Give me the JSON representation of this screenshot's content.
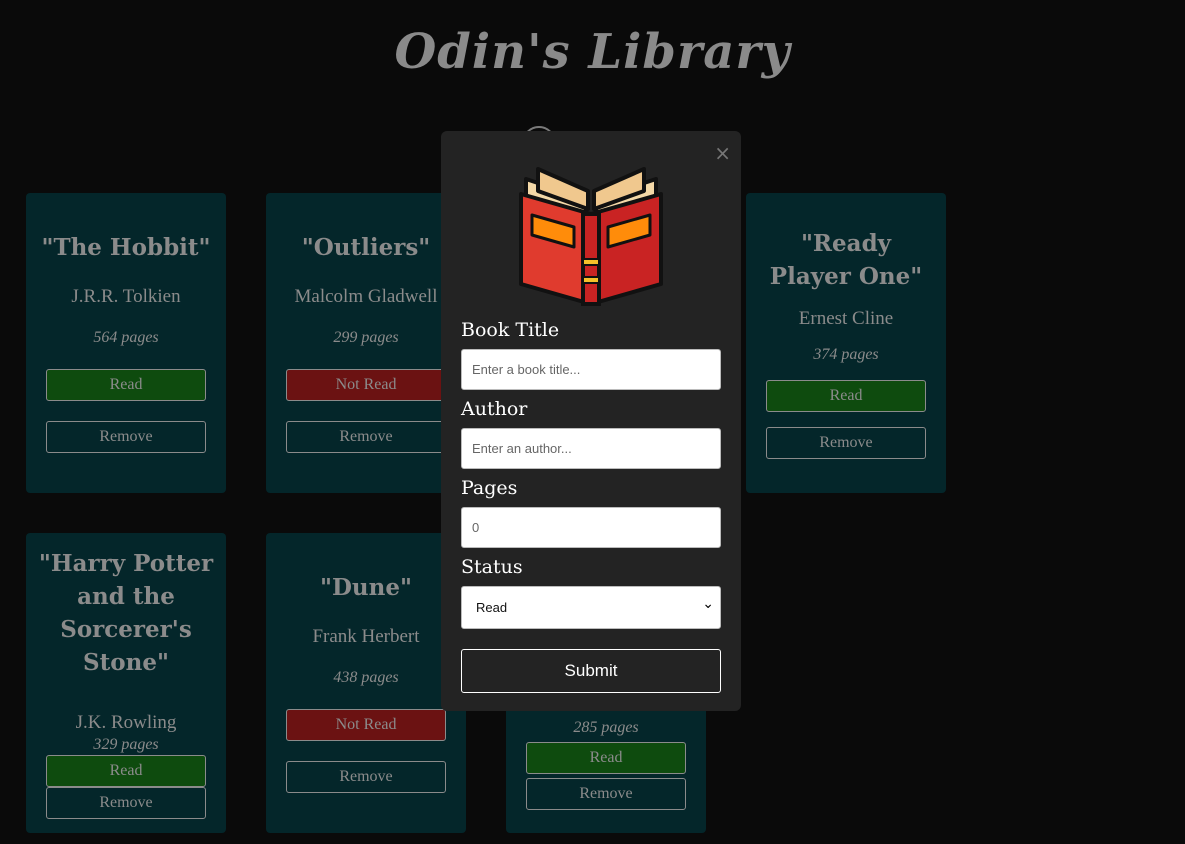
{
  "header": {
    "title": "Odin's Library"
  },
  "books": [
    {
      "title": "\"The Hobbit\"",
      "author": "J.R.R. Tolkien",
      "pages": "564 pages",
      "status": "Read",
      "remove": "Remove"
    },
    {
      "title": "\"Outliers\"",
      "author": "Malcolm Gladwell",
      "pages": "299 pages",
      "status": "Not Read",
      "remove": "Remove"
    },
    {
      "title": "\"Ready Player One\"",
      "author": "Ernest Cline",
      "pages": "374 pages",
      "status": "Read",
      "remove": "Remove"
    },
    {
      "title": "\"Harry Potter and the Sorcerer's Stone\"",
      "author": "J.K. Rowling",
      "pages": "329 pages",
      "status": "Read",
      "remove": "Remove"
    },
    {
      "title": "\"Dune\"",
      "author": "Frank Herbert",
      "pages": "438 pages",
      "status": "Not Read",
      "remove": "Remove"
    },
    {
      "title": "",
      "author": "",
      "pages": "285 pages",
      "status": "Read",
      "remove": "Remove"
    }
  ],
  "modal": {
    "close": "×",
    "title_label": "Book Title",
    "title_placeholder": "Enter a book title...",
    "author_label": "Author",
    "author_placeholder": "Enter an author...",
    "pages_label": "Pages",
    "pages_placeholder": "0",
    "status_label": "Status",
    "status_value": "Read",
    "submit": "Submit"
  },
  "colors": {
    "background": "#0a0a0a",
    "card": "#04262a",
    "read": "#0e4b0e",
    "not_read": "#6b1212",
    "modal": "#232323"
  },
  "icons": {
    "modal_illustration": "open-book-icon",
    "close": "close-icon",
    "select": "chevron-down-icon"
  }
}
